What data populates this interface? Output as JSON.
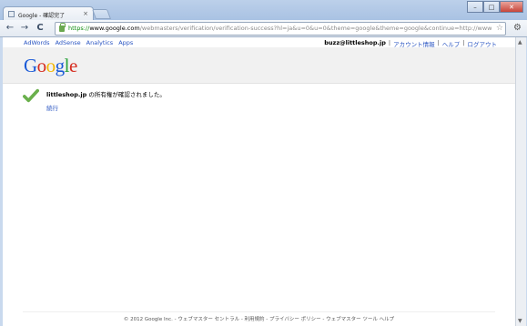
{
  "tab": {
    "title": "Google - 確認完了",
    "close": "×"
  },
  "window": {
    "minimize": "–",
    "maximize": "□",
    "close": "✕"
  },
  "toolbar": {
    "back": "←",
    "forward": "→",
    "reload": "C",
    "url_scheme": "https://",
    "url_host": "www.google.com",
    "url_rest": "/webmasters/verification/verification-success?hl=ja&u=0&u=0&theme=google&theme=google&continue=http://www.goog",
    "star": "☆",
    "wrench": "🔧"
  },
  "gbar": {
    "left_links": [
      "AdWords",
      "AdSense",
      "Analytics",
      "Apps"
    ],
    "email": "buzz@littleshop.jp",
    "sep": "|",
    "account": "アカウント情報",
    "help": "ヘルプ",
    "logout": "ログアウト"
  },
  "logo_letters": [
    "G",
    "o",
    "o",
    "g",
    "l",
    "e"
  ],
  "message": {
    "site": "littleshop.jp",
    "text": " の所有権が確認されました。"
  },
  "continue_link": "続行",
  "footer": "© 2012 Google Inc. - ウェブマスター セントラル - 利用規約 - プライバシー ポリシー - ウェブマスター ツール ヘルプ",
  "colors": {
    "check": "#6ab04c",
    "link": "#2a55c2"
  }
}
